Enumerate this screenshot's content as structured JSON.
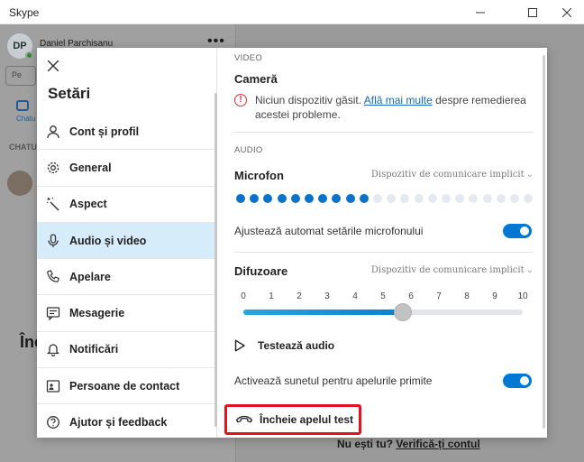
{
  "window": {
    "title": "Skype"
  },
  "background": {
    "user_initials": "DP",
    "user_name": "Daniel Parchisanu",
    "menu_dots": "•••",
    "search_placeholder": "Pe",
    "chats_label": "Chatu",
    "chats_section": "CHATU",
    "big_text": "Înc",
    "bottom_text": "Nu ești tu?",
    "bottom_link": "Verifică-ți contul"
  },
  "settings": {
    "title": "Setări",
    "nav": [
      {
        "label": "Cont și profil",
        "icon": "person-icon",
        "active": false
      },
      {
        "label": "General",
        "icon": "gear-icon",
        "active": false
      },
      {
        "label": "Aspect",
        "icon": "magic-wand-icon",
        "active": false
      },
      {
        "label": "Audio și video",
        "icon": "microphone-icon",
        "active": true
      },
      {
        "label": "Apelare",
        "icon": "phone-icon",
        "active": false
      },
      {
        "label": "Mesagerie",
        "icon": "message-icon",
        "active": false
      },
      {
        "label": "Notificări",
        "icon": "bell-icon",
        "active": false
      },
      {
        "label": "Persoane de contact",
        "icon": "contact-card-icon",
        "active": false
      },
      {
        "label": "Ajutor și feedback",
        "icon": "help-icon",
        "active": false
      }
    ]
  },
  "video": {
    "section_label": "VIDEO",
    "camera_heading": "Cameră",
    "error_prefix": "Niciun dispozitiv găsit.",
    "error_link": "Află mai multe",
    "error_suffix": "despre remedierea acestei probleme."
  },
  "audio": {
    "section_label": "AUDIO",
    "microphone_heading": "Microfon",
    "microphone_device": "Dispozitiv de comunicare implicit",
    "mic_level": {
      "active": 10,
      "total": 22
    },
    "auto_adjust_label": "Ajustează automat setările microfonului",
    "auto_adjust_on": true,
    "speaker_heading": "Difuzoare",
    "speaker_device": "Dispozitiv de comunicare implicit",
    "scale": [
      "0",
      "1",
      "2",
      "3",
      "4",
      "5",
      "6",
      "7",
      "8",
      "9",
      "10"
    ],
    "volume": 5.7,
    "test_audio_label": "Testează audio",
    "incoming_sound_label": "Activează sunetul pentru apelurile primite",
    "incoming_sound_on": true,
    "end_test_call_label": "Încheie apelul test"
  },
  "colors": {
    "accent": "#0078d4",
    "active_nav": "#d7ecfa",
    "error": "#d13438",
    "highlight_border": "#e0131f",
    "mic_dot_active": "#0a73c9",
    "mic_dot_inactive": "#e5eaf0"
  }
}
